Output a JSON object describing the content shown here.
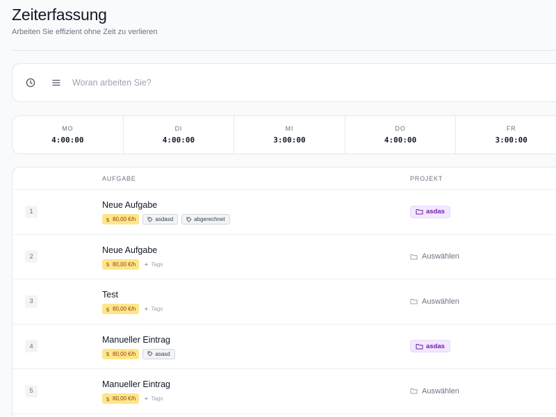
{
  "header": {
    "title": "Zeiterfassung",
    "subtitle": "Arbeiten Sie effizient ohne Zeit zu verlieren"
  },
  "timer": {
    "placeholder": "Woran arbeiten Sie?",
    "icons": [
      "clock-icon",
      "menu-lines-icon"
    ]
  },
  "week": [
    {
      "label": "MO",
      "time": "4:00:00"
    },
    {
      "label": "DI",
      "time": "4:00:00"
    },
    {
      "label": "MI",
      "time": "3:00:00"
    },
    {
      "label": "DO",
      "time": "4:00:00"
    },
    {
      "label": "FR",
      "time": "3:00:00"
    }
  ],
  "table": {
    "headers": {
      "task": "AUFGABE",
      "project": "PROJEKT"
    },
    "rows": [
      {
        "num": "1",
        "name": "Neue Aufgabe",
        "rate": "80,00 €/h",
        "tags": [
          "asdasd",
          "abgerechnet"
        ],
        "add_tags": "",
        "project": "asdas",
        "project_select": ""
      },
      {
        "num": "2",
        "name": "Neue Aufgabe",
        "rate": "80,00 €/h",
        "tags": [],
        "add_tags": "Tags",
        "project": "",
        "project_select": "Auswählen"
      },
      {
        "num": "3",
        "name": "Test",
        "rate": "80,00 €/h",
        "tags": [],
        "add_tags": "Tags",
        "project": "",
        "project_select": "Auswählen"
      },
      {
        "num": "4",
        "name": "Manueller Eintrag",
        "rate": "80,00 €/h",
        "tags": [
          "asasd"
        ],
        "add_tags": "",
        "project": "asdas",
        "project_select": ""
      },
      {
        "num": "5",
        "name": "Manueller Eintrag",
        "rate": "80,00 €/h",
        "tags": [],
        "add_tags": "Tags",
        "project": "",
        "project_select": "Auswählen"
      }
    ]
  },
  "colors": {
    "rate_bg": "#fde68a",
    "project_bg": "#f3e8ff",
    "project_text": "#6b21a8"
  }
}
